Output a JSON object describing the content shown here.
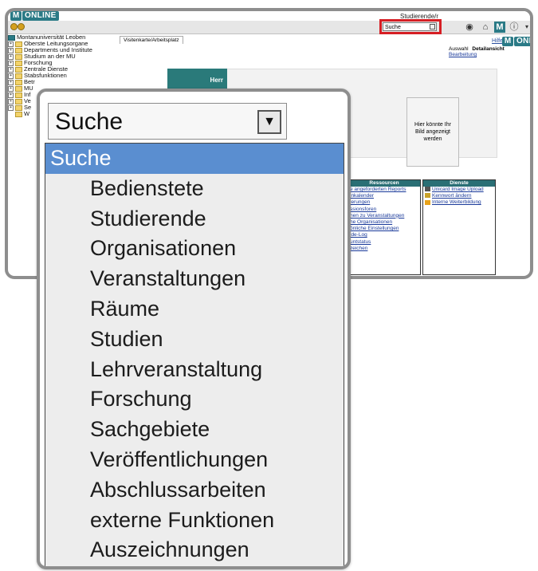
{
  "app": {
    "logo_letter": "M",
    "logo_text": "ONLINE",
    "role_label": "Studierende/r",
    "search_select_value": "Suche",
    "colors": {
      "accent": "#2a7a86",
      "highlight_red": "#d61e24",
      "selected_option": "#5a8ed0"
    }
  },
  "tree": {
    "root": "Montanuniversität Leoben",
    "items": [
      "Oberste Leitungsorgane",
      "Departments und Institute",
      "Studium an der MU",
      "Forschung",
      "Zentrale Dienste",
      "Stabsfunktionen",
      "Betr",
      "MU",
      "Inf",
      "Ve",
      "Se",
      "W"
    ]
  },
  "content": {
    "tab_label": "Visitenkarte/Arbeitsplatz",
    "help_link": "Hilfe",
    "view_tabs": [
      "Auswahl",
      "Detailansicht",
      "Bearbeitung"
    ],
    "greeting": "Herr",
    "photo_placeholder": "Hier könnte Ihr Bild angezeigt werden",
    "ressourcen": {
      "title": "Ressourcen",
      "links": [
        "e angeforderten Reports",
        "inkalender",
        "ierungen",
        "ssionsforen",
        "nen zu Veranstaltungen",
        "he Organisationen",
        "önliche Einstellungen",
        "ide-Log",
        "untstatus",
        "zeichen"
      ]
    },
    "dienste": {
      "title": "Dienste",
      "links": [
        "Unicard Image Upload",
        "Kennwort ändern",
        "Interne Weiterbildung"
      ]
    }
  },
  "zoom": {
    "select_value": "Suche",
    "options": [
      "Suche",
      "Bedienstete",
      "Studierende",
      "Organisationen",
      "Veranstaltungen",
      "Räume",
      "Studien",
      "Lehrveranstaltung",
      "Forschung",
      "Sachgebiete",
      "Veröffentlichungen",
      "Abschlussarbeiten",
      "externe Funktionen",
      "Auszeichnungen"
    ],
    "selected_index": 0
  }
}
